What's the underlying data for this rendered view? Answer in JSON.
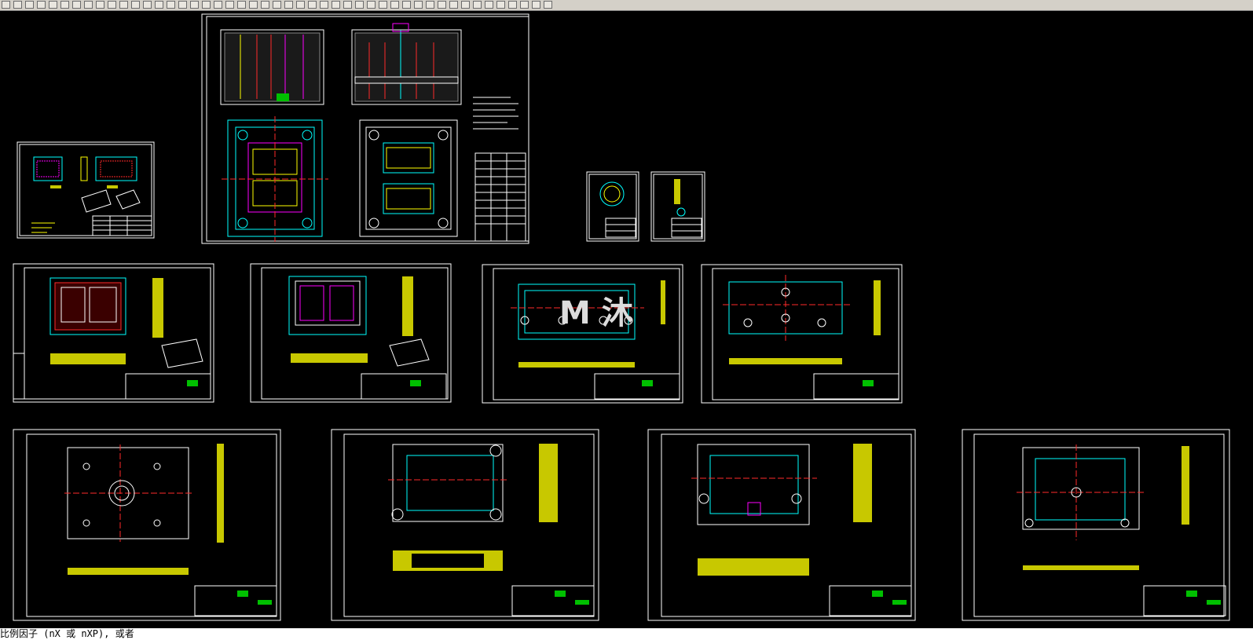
{
  "app": {
    "toolbar_tools": [
      "new-icon",
      "open-icon",
      "save-icon",
      "plot-icon",
      "preview-icon",
      "cut-icon",
      "copy-icon",
      "paste-icon",
      "match-properties-icon",
      "undo-icon",
      "redo-icon",
      "pan-icon",
      "zoom-icon",
      "layer-icon",
      "draw-line-icon",
      "draw-polyline-icon",
      "draw-circle-icon",
      "draw-arc-icon",
      "hatch-icon",
      "dimension-icon",
      "text-icon",
      "block-icon",
      "insert-icon",
      "properties-icon",
      "design-center-icon",
      "tool-palette-icon",
      "erase-icon",
      "move-icon",
      "rotate-icon",
      "scale-icon",
      "trim-icon",
      "extend-icon",
      "fillet-icon",
      "chamfer-icon",
      "explode-icon",
      "array-icon",
      "mirror-icon",
      "offset-icon",
      "stretch-icon",
      "break-icon",
      "join-icon",
      "measure-icon",
      "list-icon",
      "layout-icon",
      "viewport-icon",
      "render-icon",
      "help-icon"
    ],
    "command_line_text": "比例因子 (nX 或 nXP), 或者",
    "watermark_text": "M 沐"
  },
  "colors": {
    "background": "#000000",
    "sheet_border": "#ffffff",
    "geometry": "#00ffff",
    "centerline": "#ff2a2a",
    "hatch": "#c8c800",
    "accent": "#00c000",
    "text": "#ffff00",
    "component": "#ff00ff"
  }
}
